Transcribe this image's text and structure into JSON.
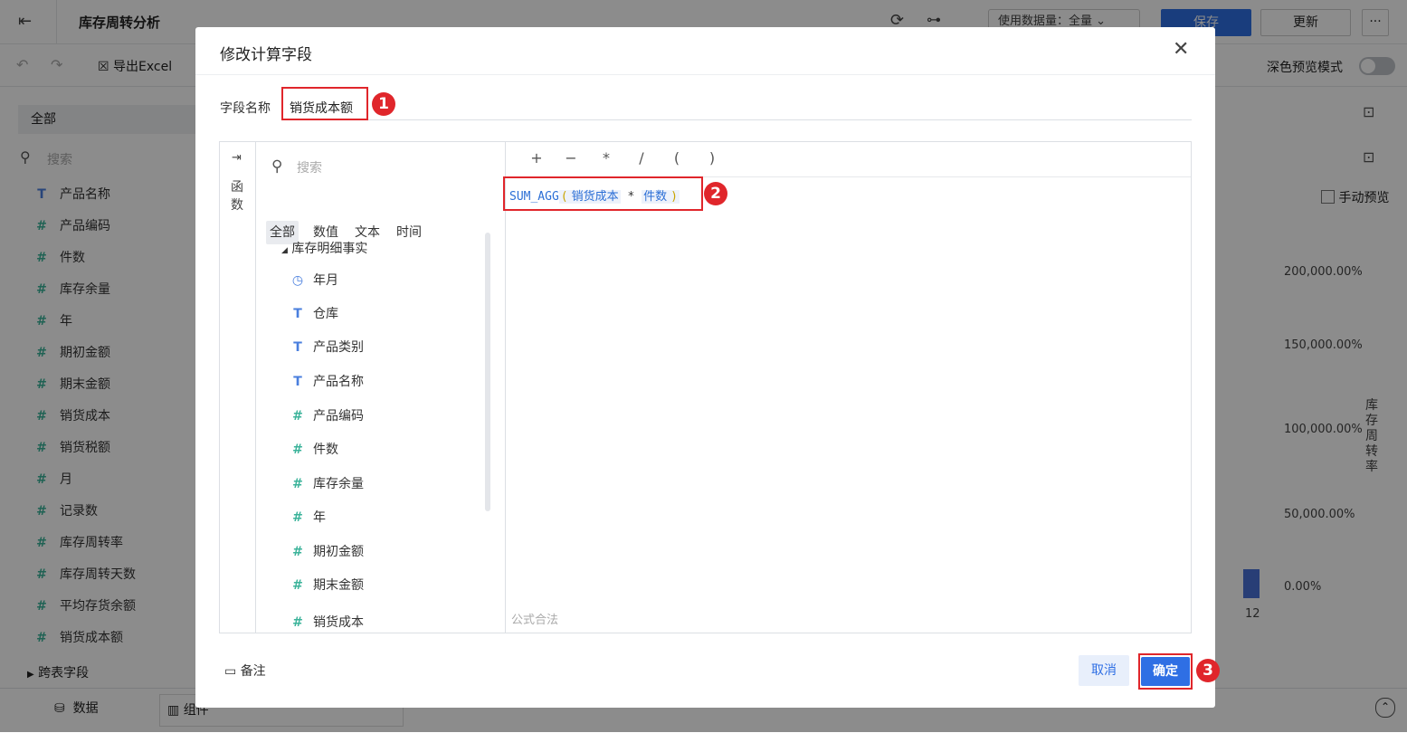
{
  "app": {
    "back_icon": "back-icon",
    "title": "库存周转分析",
    "data_volume": "使用数据量：全量",
    "save": "保存",
    "update": "更新",
    "more": "···"
  },
  "toolbar": {
    "export_excel": "导出Excel",
    "dark_preview": "深色预览模式"
  },
  "left": {
    "scope": "全部",
    "search_placeholder": "搜索",
    "fields": [
      {
        "icon": "T",
        "label": "产品名称"
      },
      {
        "icon": "#",
        "label": "产品编码"
      },
      {
        "icon": "#",
        "label": "件数"
      },
      {
        "icon": "#",
        "label": "库存余量"
      },
      {
        "icon": "#",
        "label": "年"
      },
      {
        "icon": "#",
        "label": "期初金额"
      },
      {
        "icon": "#",
        "label": "期末金额"
      },
      {
        "icon": "#",
        "label": "销货成本"
      },
      {
        "icon": "#",
        "label": "销货税额"
      },
      {
        "icon": "#",
        "label": "月"
      },
      {
        "icon": "#",
        "label": "记录数"
      },
      {
        "icon": "#",
        "label": "库存周转率"
      },
      {
        "icon": "#",
        "label": "库存周转天数"
      },
      {
        "icon": "#",
        "label": "平均存货余额"
      },
      {
        "icon": "#",
        "label": "销货成本额"
      }
    ],
    "cross_table": "跨表字段"
  },
  "bottom": {
    "data_tab": "数据",
    "component_tab": "组件"
  },
  "chart_bg": {
    "manual_preview": "手动预览",
    "y_ticks": [
      "200,000.00%",
      "150,000.00%",
      "100,000.00%",
      "50,000.00%",
      "0.00%"
    ],
    "ylabel": "库存周转率",
    "x_tick": "12"
  },
  "dialog": {
    "title": "修改计算字段",
    "name_label": "字段名称",
    "name_value": "销货成本额",
    "func_tab": "函数",
    "search_placeholder": "搜索",
    "categories": [
      "全部",
      "数值",
      "文本",
      "时间"
    ],
    "tree_root": "库存明细事实",
    "tree_items": [
      {
        "icon": "clock",
        "label": "年月"
      },
      {
        "icon": "T",
        "label": "仓库"
      },
      {
        "icon": "T",
        "label": "产品类别"
      },
      {
        "icon": "T",
        "label": "产品名称"
      },
      {
        "icon": "#",
        "label": "产品编码"
      },
      {
        "icon": "#",
        "label": "件数"
      },
      {
        "icon": "#",
        "label": "库存余量"
      },
      {
        "icon": "#",
        "label": "年"
      },
      {
        "icon": "#",
        "label": "期初金额"
      },
      {
        "icon": "#",
        "label": "期末金额"
      },
      {
        "icon": "#",
        "label": "销货成本"
      }
    ],
    "operators": [
      "+",
      "−",
      "*",
      "/",
      "(",
      ")"
    ],
    "formula": {
      "func": "SUM_AGG",
      "open": "(",
      "field1": "销货成本",
      "op": "*",
      "field2": "件数",
      "close": ")"
    },
    "status": "公式合法",
    "remark": "备注",
    "cancel": "取消",
    "confirm": "确定",
    "badges": [
      "1",
      "2",
      "3"
    ]
  },
  "colors": {
    "primary": "#2f6fe4",
    "annotation_red": "#e0262b",
    "number_icon": "#3bb39a",
    "text_icon": "#4a7fde"
  }
}
